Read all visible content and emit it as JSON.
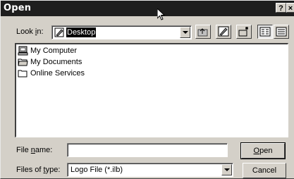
{
  "window": {
    "title": "Open",
    "help_button": "?",
    "close_button": "×"
  },
  "look_in": {
    "label_prefix": "Look ",
    "label_accel": "i",
    "label_suffix": "n:",
    "selected": "Desktop"
  },
  "toolbar": {
    "buttons": [
      "up-one-level",
      "desktop",
      "new-folder",
      "list-view",
      "details-view"
    ]
  },
  "file_list": {
    "items": [
      {
        "label": "My Computer",
        "icon": "computer-icon"
      },
      {
        "label": "My Documents",
        "icon": "folder-icon"
      },
      {
        "label": "Online Services",
        "icon": "folder-icon"
      }
    ]
  },
  "file_name": {
    "label_prefix": "File ",
    "label_accel": "n",
    "label_suffix": "ame:",
    "value": ""
  },
  "files_of_type": {
    "label_prefix": "Files of ",
    "label_accel": "t",
    "label_suffix": "ype:",
    "selected": "Logo File (*.ilb)"
  },
  "buttons": {
    "open_accel": "O",
    "open_rest": "pen",
    "cancel": "Cancel"
  }
}
